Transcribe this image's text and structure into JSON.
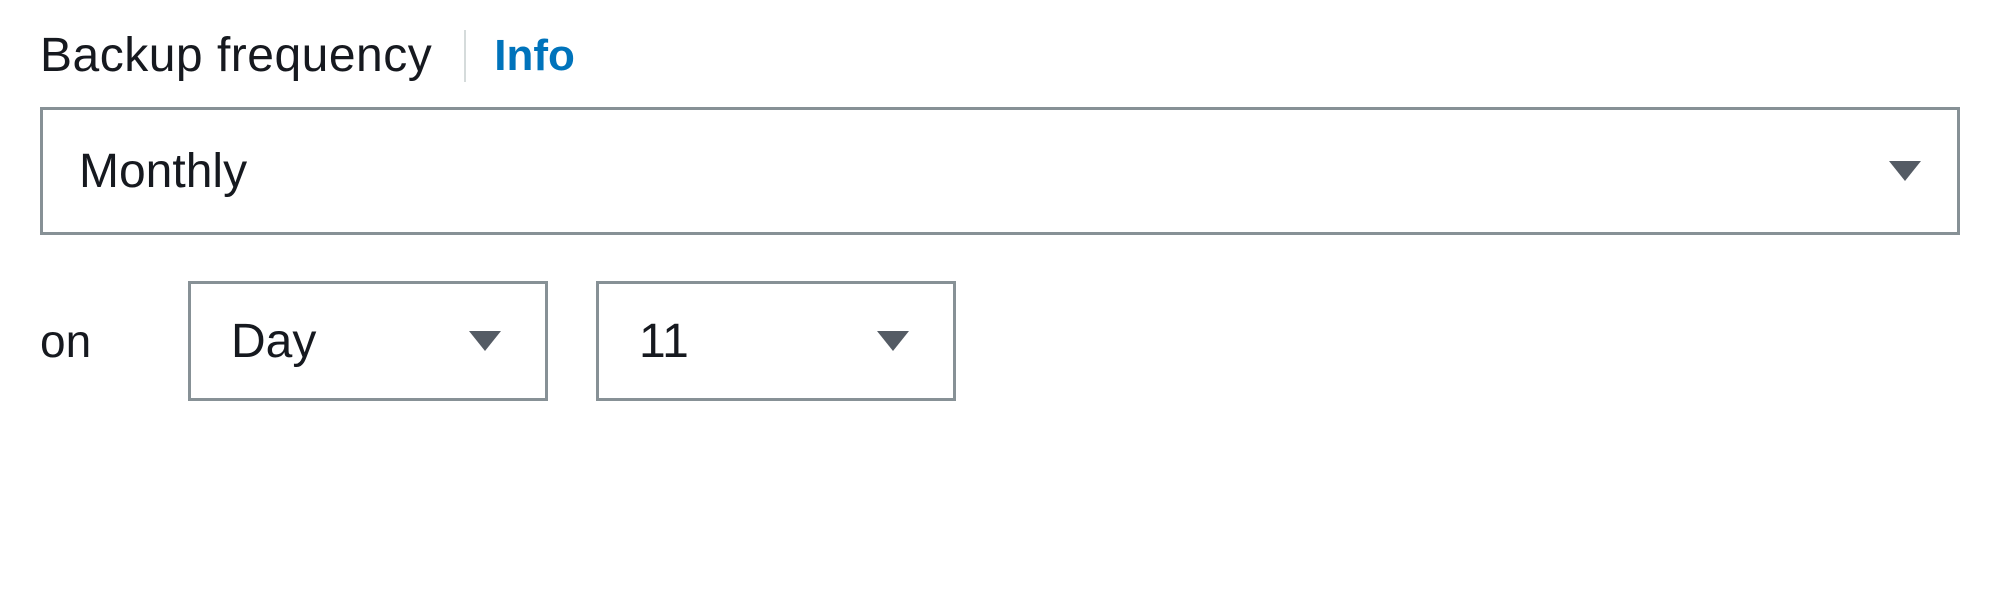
{
  "backup": {
    "label": "Backup frequency",
    "info": "Info",
    "frequency": "Monthly",
    "on_label": "on",
    "day_type": "Day",
    "day_value": "11"
  }
}
